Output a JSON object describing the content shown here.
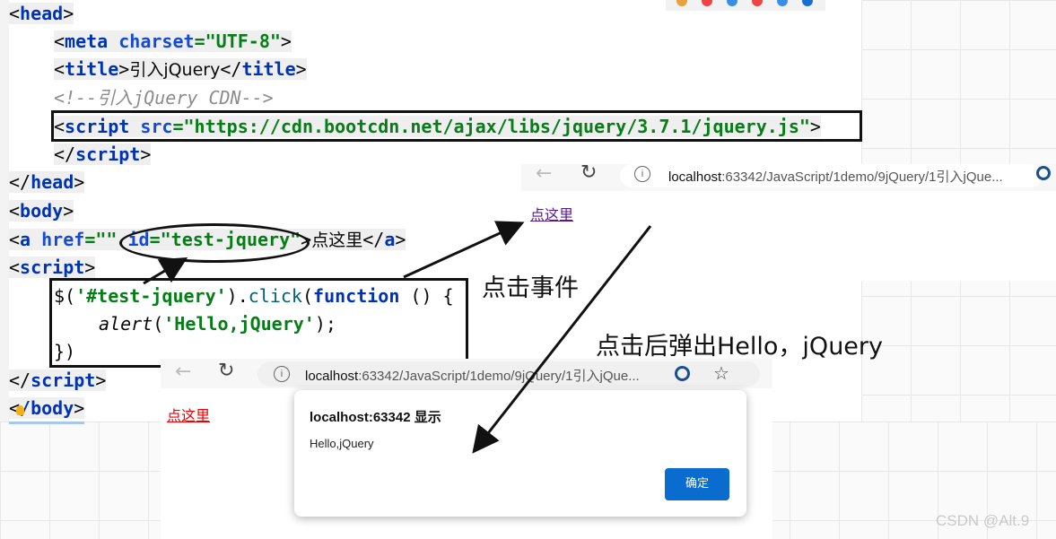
{
  "editor": {
    "lines": {
      "l1": {
        "t1": "<",
        "t2": "head",
        "t3": ">"
      },
      "l2": {
        "t1": "<",
        "t2": "meta ",
        "t3": "charset",
        "t4": "=",
        "t5": "\"UTF-8\"",
        "t6": ">"
      },
      "l3": {
        "t1": "<",
        "t2": "title",
        "t3": ">",
        "t4": "引入jQuery",
        "t5": "</",
        "t6": "title",
        "t7": ">"
      },
      "l4": {
        "t1": "<!--引入jQuery CDN-->"
      },
      "l5": {
        "t1": "<",
        "t2": "script ",
        "t3": "src",
        "t4": "=",
        "t5": "\"https://cdn.bootcdn.net/ajax/libs/jquery/3.7.1/jquery.js\"",
        "t6": ">"
      },
      "l6": {
        "t1": "</",
        "t2": "script",
        "t3": ">"
      },
      "l7": {
        "t1": "</",
        "t2": "head",
        "t3": ">"
      },
      "l8": {
        "t1": "<",
        "t2": "body",
        "t3": ">"
      },
      "l9": {
        "t1": "<",
        "t2": "a ",
        "t3": "href",
        "t4": "=",
        "t5": "\"\" ",
        "t6": "id",
        "t7": "=",
        "t8": "\"test-jquery\"",
        "t9": ">",
        "t10": "点这里",
        "t11": "</",
        "t12": "a",
        "t13": ">"
      },
      "l10": {
        "t1": "<",
        "t2": "script",
        "t3": ">"
      },
      "l11": {
        "t1": "$(",
        "t2": "'#test-jquery'",
        "t3": ").",
        "t4": "click",
        "t5": "(",
        "t6": "function",
        "t7": " () {"
      },
      "l12": {
        "t1": "alert",
        "t2": "(",
        "t3": "'Hello,jQuery'",
        "t4": ");"
      },
      "l13": {
        "t1": "})"
      },
      "l14": {
        "t1": "</",
        "t2": "script",
        "t3": ">"
      },
      "l15": {
        "t1": "<",
        "t2": "/body",
        "t3": ">"
      }
    }
  },
  "browser1": {
    "url_host": "localhost",
    "url_rest": ":63342/JavaScript/1demo/9jQuery/1引入jQue...",
    "link_text": "点这里"
  },
  "browser2": {
    "url_host": "localhost",
    "url_rest": ":63342/JavaScript/1demo/9jQuery/1引入jQue...",
    "link_text": "点这里"
  },
  "dialog": {
    "title": "localhost:63342 显示",
    "message": "Hello,jQuery",
    "ok_label": "确定"
  },
  "annotations": {
    "click_event": "点击事件",
    "popup": "点击后弹出Hello，jQuery"
  },
  "watermark": "CSDN @Alt.9",
  "icons": {
    "back": "back-arrow-icon",
    "reload": "reload-icon",
    "info": "info-icon",
    "edge": "edge-icon",
    "star": "star-icon"
  }
}
